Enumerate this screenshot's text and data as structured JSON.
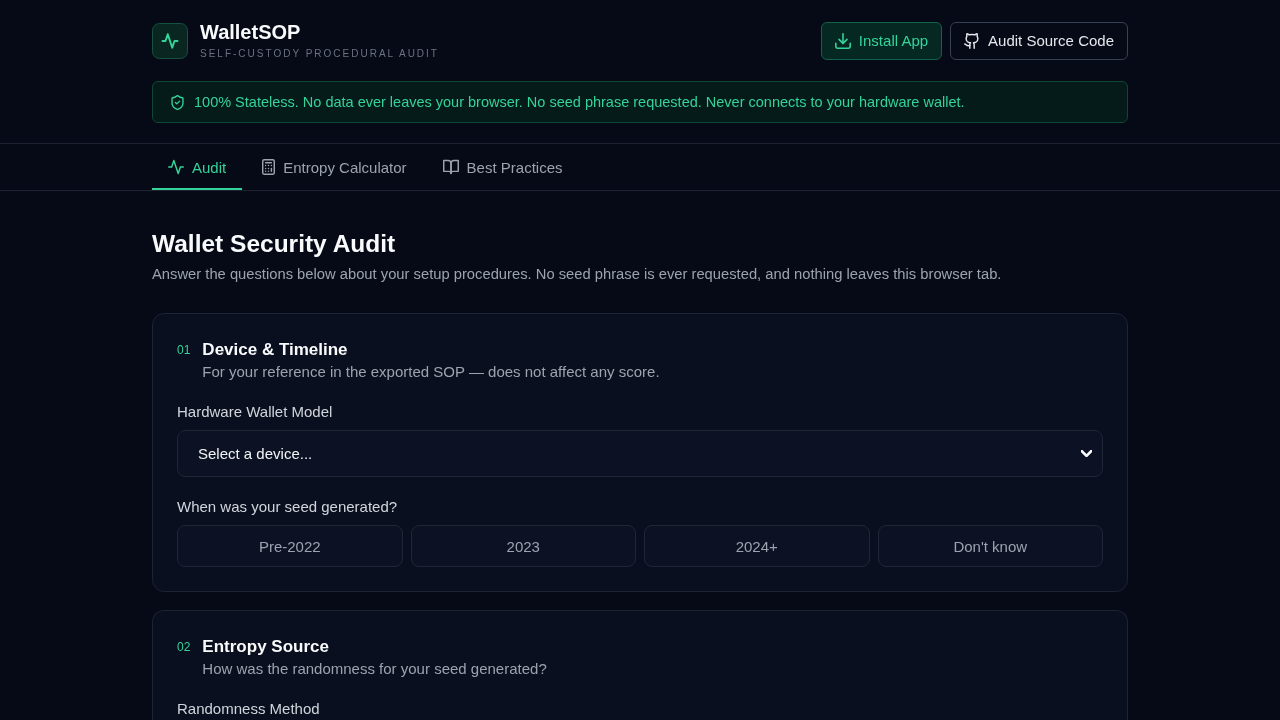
{
  "header": {
    "title": "WalletSOP",
    "tagline": "SELF-CUSTODY PROCEDURAL AUDIT",
    "buttons": [
      {
        "label": "Install App",
        "kind": "primary"
      },
      {
        "label": "Audit Source Code",
        "kind": "secondary"
      }
    ]
  },
  "privacy_banner": {
    "text": "100% Stateless. No data ever leaves your browser. No seed phrase requested. Never connects to your hardware wallet."
  },
  "tabs": [
    {
      "label": "Audit",
      "selected": true
    },
    {
      "label": "Entropy Calculator",
      "selected": false
    },
    {
      "label": "Best Practices",
      "selected": false
    }
  ],
  "page": {
    "title": "Wallet Security Audit",
    "description": "Answer the questions below about your setup procedures. No seed phrase is ever requested, and nothing leaves this browser tab."
  },
  "sections": [
    {
      "number": "01",
      "title": "Device & Timeline",
      "subtitle": "For your reference in the exported SOP — does not affect any score.",
      "fields": [
        {
          "kind": "select",
          "label": "Hardware Wallet Model",
          "placeholder": "Select a device..."
        },
        {
          "kind": "choices",
          "label": "When was your seed generated?",
          "options": [
            {
              "label": "Pre-2022",
              "selected": false
            },
            {
              "label": "2023",
              "selected": false
            },
            {
              "label": "2024+",
              "selected": false
            },
            {
              "label": "Don't know",
              "selected": false
            }
          ]
        }
      ]
    },
    {
      "number": "02",
      "title": "Entropy Source",
      "subtitle": "How was the randomness for your seed generated?",
      "fields": [
        {
          "label": "Randomness Method"
        }
      ]
    }
  ]
}
